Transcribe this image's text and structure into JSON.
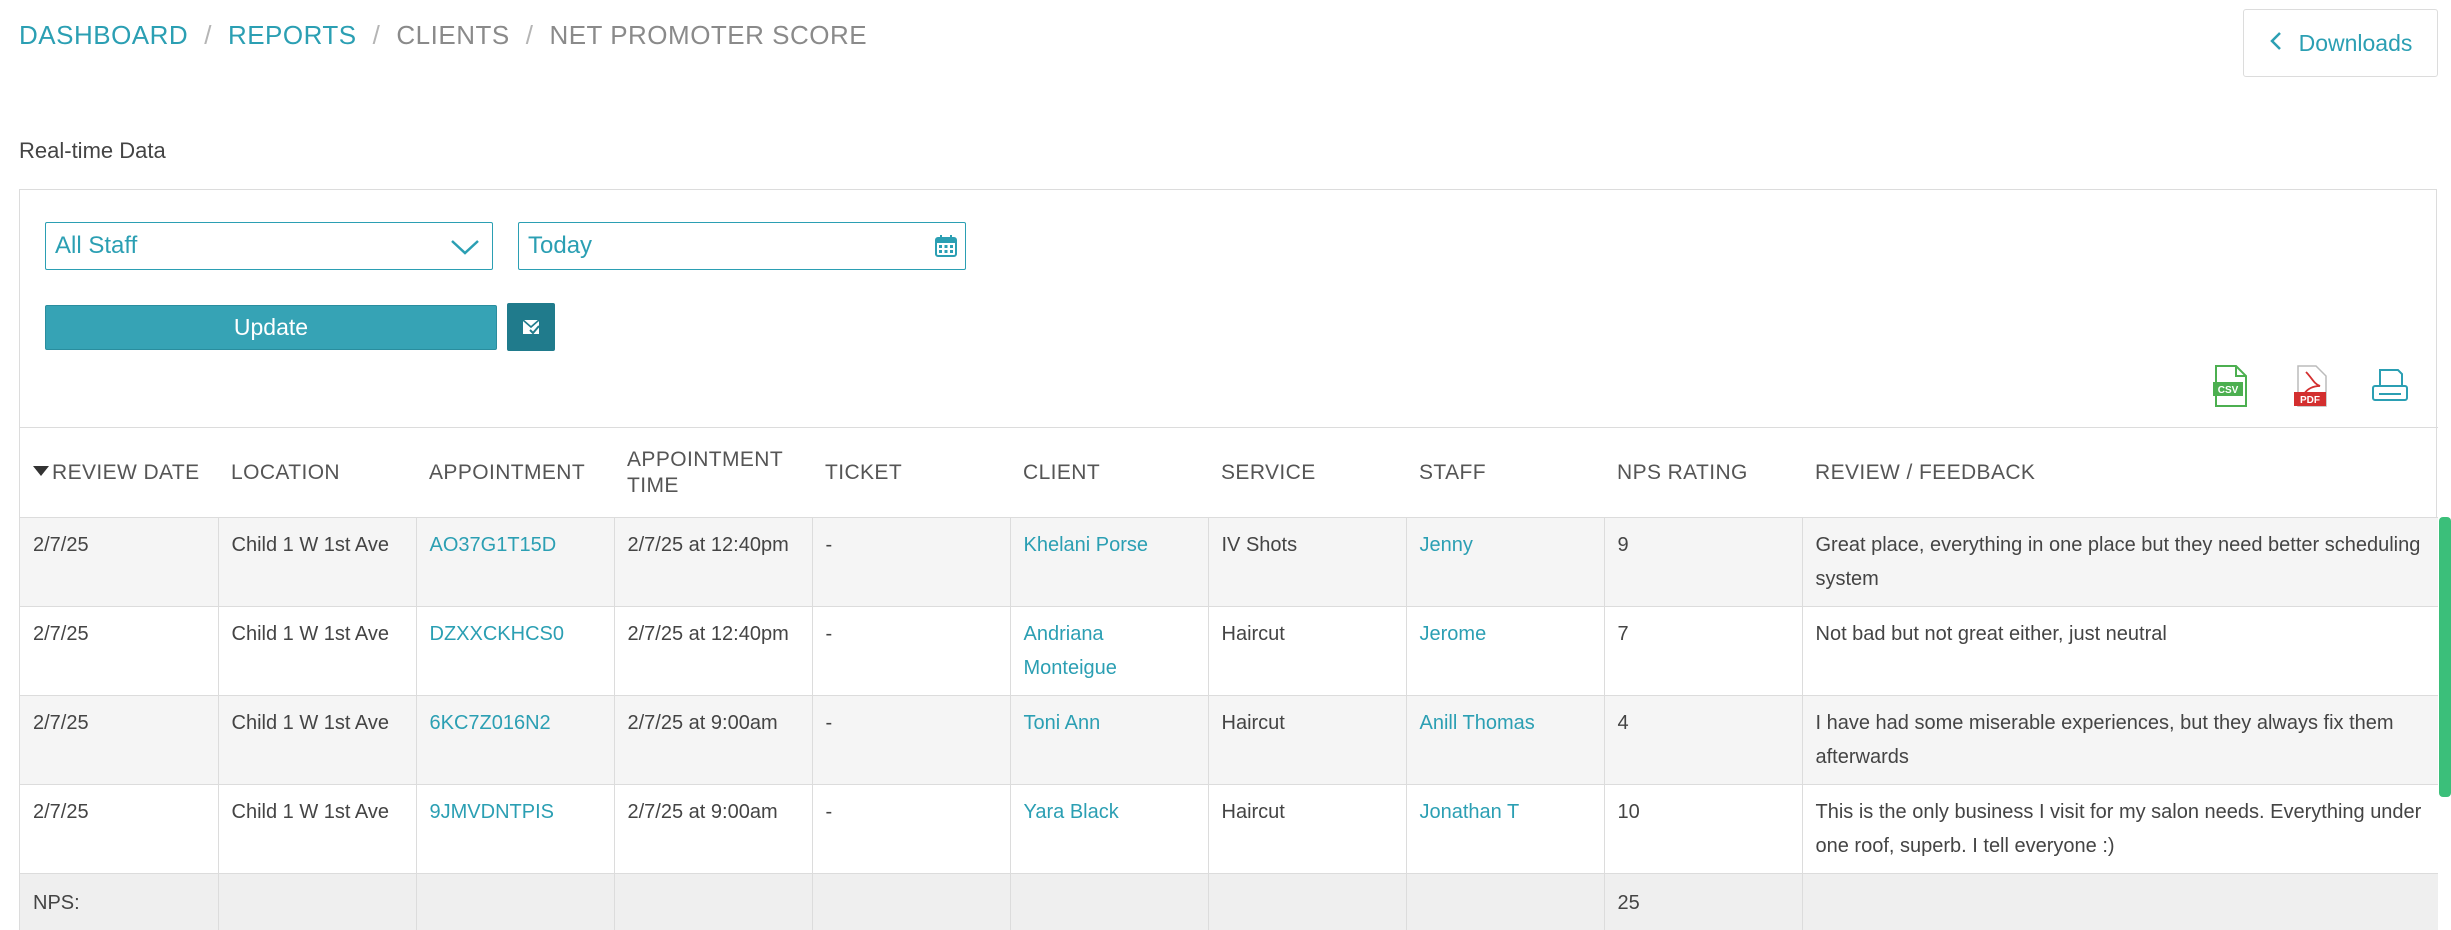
{
  "breadcrumb": {
    "dashboard": "DASHBOARD",
    "reports": "REPORTS",
    "clients": "CLIENTS",
    "current": "NET PROMOTER SCORE",
    "separator": "/"
  },
  "header": {
    "downloads_label": "Downloads"
  },
  "section_label": "Real-time Data",
  "filters": {
    "staff_selected": "All Staff",
    "date_value": "Today",
    "update_label": "Update"
  },
  "export": {
    "csv_label": "CSV",
    "pdf_label": "PDF"
  },
  "table": {
    "columns": [
      "REVIEW DATE",
      "LOCATION",
      "APPOINTMENT",
      "APPOINTMENT TIME",
      "TICKET",
      "CLIENT",
      "SERVICE",
      "STAFF",
      "NPS RATING",
      "REVIEW / FEEDBACK"
    ],
    "rows": [
      {
        "review_date": "2/7/25",
        "location": "Child 1 W 1st Ave",
        "appointment": "AO37G1T15D",
        "appointment_time": "2/7/25 at 12:40pm",
        "ticket": "-",
        "client": "Khelani Porse",
        "service": "IV Shots",
        "staff": "Jenny",
        "nps": "9",
        "feedback": "Great place, everything in one place but they need better scheduling system"
      },
      {
        "review_date": "2/7/25",
        "location": "Child 1 W 1st Ave",
        "appointment": "DZXXCKHCS0",
        "appointment_time": "2/7/25 at 12:40pm",
        "ticket": "-",
        "client": "Andriana Monteigue",
        "service": "Haircut",
        "staff": "Jerome",
        "nps": "7",
        "feedback": "Not bad but not great either, just neutral"
      },
      {
        "review_date": "2/7/25",
        "location": "Child 1 W 1st Ave",
        "appointment": "6KC7Z016N2",
        "appointment_time": "2/7/25 at 9:00am",
        "ticket": "-",
        "client": "Toni Ann",
        "service": "Haircut",
        "staff": "Anill Thomas",
        "nps": "4",
        "feedback": "I have had some miserable experiences, but they always fix them afterwards"
      },
      {
        "review_date": "2/7/25",
        "location": "Child 1 W 1st Ave",
        "appointment": "9JMVDNTPIS",
        "appointment_time": "2/7/25 at 9:00am",
        "ticket": "-",
        "client": "Yara Black",
        "service": "Haircut",
        "staff": "Jonathan T",
        "nps": "10",
        "feedback": "This is the only business I visit for my salon needs. Everything under one roof, superb. I tell everyone :)"
      }
    ],
    "footer": {
      "label": "NPS:",
      "value": "25"
    }
  },
  "colors": {
    "accent": "#2b9fb3",
    "button": "#36a3b5",
    "scrollbar": "#3bbf7a"
  }
}
